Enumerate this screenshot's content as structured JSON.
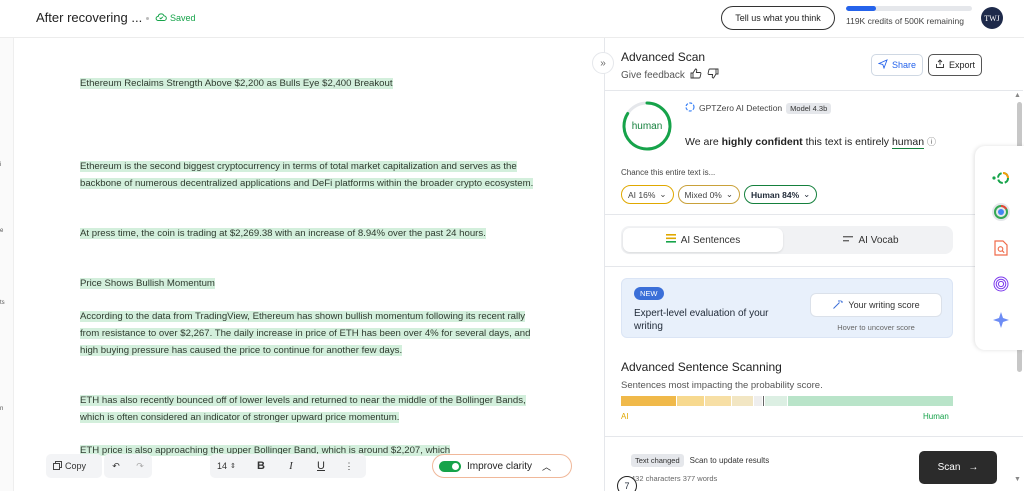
{
  "header": {
    "doc_title": "After recovering ...",
    "saved": "Saved",
    "tell_btn": "Tell us what you think",
    "credits_text": "119K credits of 500K remaining",
    "credits_fraction": 0.238,
    "avatar": "TWJ"
  },
  "sidebar_stub": [
    "i",
    "e",
    "ts",
    "n"
  ],
  "document": {
    "p1": "Ethereum Reclaims Strength Above $2,200 as Bulls Eye $2,400 Breakout",
    "p2": "Ethereum is the second biggest cryptocurrency in terms of total market capitalization and serves as the backbone of numerous decentralized applications and DeFi platforms within the broader crypto ecosystem.",
    "p3": "At press time, the coin is trading at  $2,269.38 with an increase of 8.94% over the past 24 hours.",
    "p4": "Price Shows Bullish Momentum",
    "p5": "According to the data from TradingView, Ethereum has shown bullish momentum following its recent rally from resistance to over $2,267. The daily increase in price of ETH has been over 4% for several days, and high buying pressure has caused the price to continue for another few days.",
    "p6": "ETH has also recently bounced off of lower levels and returned to near the middle of the Bollinger Bands, which is often considered an indicator of stronger upward price momentum.",
    "p7": "ETH price is also approaching the upper Bollinger Band, which is around $2,207, which"
  },
  "toolbar": {
    "copy": "Copy",
    "font_size": "14",
    "bold": "B",
    "italic": "I",
    "underline": "U",
    "more": "⋮",
    "improve": "Improve clarity"
  },
  "panel": {
    "title": "Advanced Scan",
    "feedback": "Give feedback",
    "share": "Share",
    "export": "Export",
    "ring_label": "human",
    "ring_fraction": 0.84,
    "detect_label": "GPTZero AI Detection",
    "model": "Model 4.3b",
    "confident_pre": "We are",
    "confident_bold": "highly confident",
    "confident_mid": "this text is entirely",
    "confident_word": "human",
    "chance": "Chance this entire text is...",
    "pills": [
      {
        "label": "AI 16%",
        "color": "#e0a800"
      },
      {
        "label": "Mixed 0%",
        "color": "#c9a13a"
      },
      {
        "label": "Human 84%",
        "color": "#15803d"
      }
    ],
    "tab_sentences": "AI Sentences",
    "tab_vocab": "AI Vocab",
    "new_badge": "NEW",
    "new_text": "Expert-level evaluation of your writing",
    "score_btn": "Your writing score",
    "hover_text": "Hover to uncover score",
    "ass_title": "Advanced Sentence Scanning",
    "ass_sub": "Sentences most impacting the probability score.",
    "ai_label": "AI",
    "human_label": "Human",
    "changed_badge": "Text changed",
    "changed_text": "Scan to update results",
    "counts": "432 characters 377 words",
    "seven": "7",
    "scan": "Scan"
  },
  "colors": {
    "highlight": "#d3efdc",
    "underline": "#f2c94c",
    "accent_blue": "#2563eb",
    "human_green": "#15803d"
  }
}
